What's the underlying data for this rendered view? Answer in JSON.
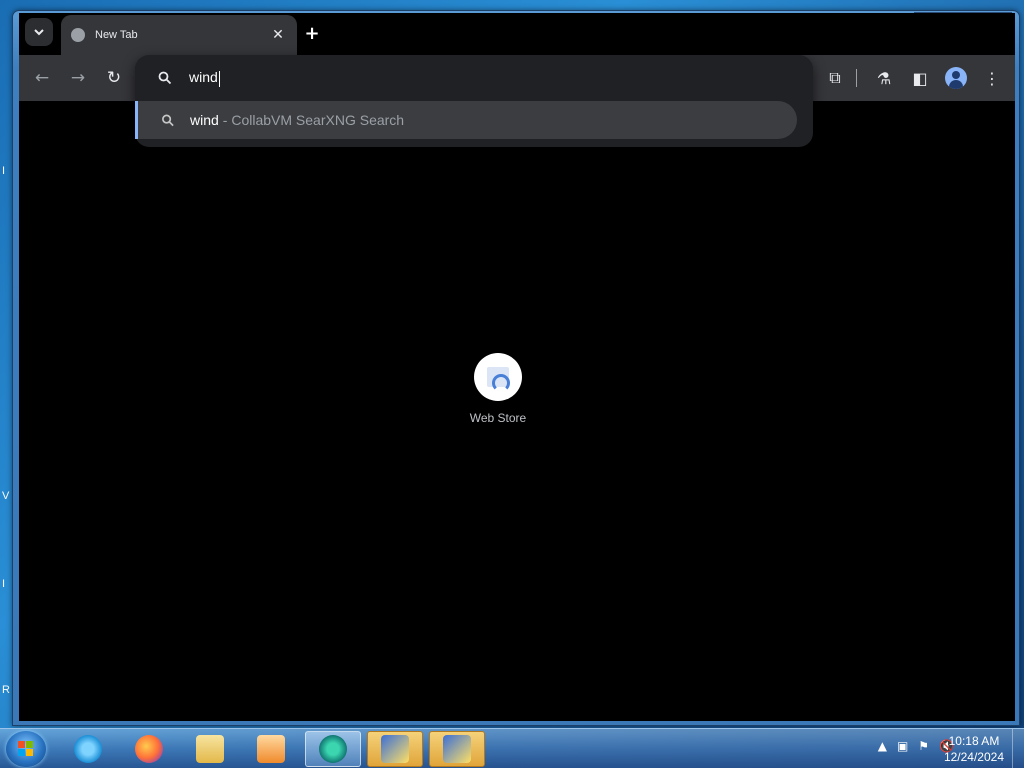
{
  "window": {
    "controls": {
      "minimize": "▬",
      "maximize": "▢",
      "close": "✕"
    }
  },
  "tabstrip": {
    "tab_search_icon": "chevron-down-icon",
    "tabs": [
      {
        "title": "New Tab",
        "favicon": "globe-icon",
        "close": "✕"
      }
    ],
    "new_tab": "+"
  },
  "toolbar": {
    "back": "←",
    "forward": "→",
    "reload": "↻",
    "extensions": "⧉",
    "labs": "⚗",
    "side_panel": "◧",
    "menu": "⋮"
  },
  "omnibox": {
    "value": "wind",
    "suggestion": {
      "match": "wind",
      "description": "- CollabVM SearXNG Search"
    }
  },
  "ntp": {
    "shortcuts": [
      {
        "label": "Web Store"
      }
    ]
  },
  "taskbar": {
    "apps": [
      "internet-explorer",
      "firefox",
      "file-explorer",
      "media-player",
      "browser",
      "installer",
      "installer"
    ],
    "clock": {
      "time": "10:18 AM",
      "date": "12/24/2024"
    }
  },
  "desktop": {
    "edge_letters": [
      "I",
      "V",
      "I",
      "R"
    ]
  },
  "colors": {
    "accent": "#8ab4f8",
    "toolbar_bg": "#35363a",
    "omnibox_bg": "#202124"
  }
}
